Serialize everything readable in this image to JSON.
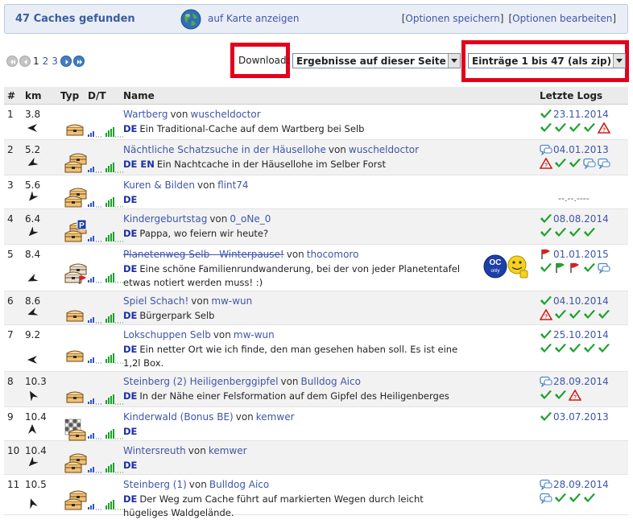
{
  "header": {
    "caches_found": "47 Caches gefunden",
    "map_link": "auf Karte anzeigen",
    "options_save": "Optionen speichern",
    "options_edit": "Optionen bearbeiten"
  },
  "pager": {
    "pages": [
      "1",
      "2",
      "3"
    ],
    "current": "1"
  },
  "download": {
    "label": "Download:",
    "results_select": "Ergebnisse auf dieser Seite",
    "entries_select": "Einträge 1 bis 47 (als zip)"
  },
  "table": {
    "headers": {
      "num": "#",
      "km": "km",
      "type": "Typ",
      "dt": "D/T",
      "name": "Name",
      "logs": "Letzte Logs"
    },
    "rows": [
      {
        "num": "1",
        "km": "3.8",
        "name": "Wartberg",
        "von": "von",
        "owner": "wuscheldoctor",
        "langs": "DE",
        "desc": "Ein Traditional-Cache auf dem Wartberg bei Selb",
        "log_date": "23.11.2014",
        "log_date_icon": "check-icon",
        "logs": [
          "check-icon",
          "check-icon",
          "check-icon",
          "check-icon",
          "dnf-icon"
        ],
        "type_icon": "traditional-cache-icon"
      },
      {
        "num": "2",
        "km": "5.2",
        "name": "Nächtliche Schatzsuche in der Häusellohe",
        "von": "von",
        "owner": "wuscheldoctor",
        "langs": "DE EN",
        "desc": "Ein Nachtcache in der Häusellohe im Selber Forst",
        "log_date": "04.01.2013",
        "log_date_icon": "note-icon",
        "logs": [
          "dnf-icon",
          "check-icon",
          "check-icon",
          "note-icon",
          "note-icon"
        ],
        "type_icon": "multi-cache-icon"
      },
      {
        "num": "3",
        "km": "5.6",
        "name": "Kuren & Bilden",
        "von": "von",
        "owner": "flint74",
        "langs": "DE",
        "desc": "",
        "log_date": "",
        "no_log": "--.--.----",
        "logs": [],
        "type_icon": "multi-cache-icon"
      },
      {
        "num": "4",
        "km": "6.4",
        "name": "Kindergeburtstag",
        "von": "von",
        "owner": "0_oNe_0",
        "langs": "DE",
        "desc": "Pappa, wo feiern wir heute?",
        "log_date": "08.08.2014",
        "log_date_icon": "check-icon",
        "logs": [
          "check-icon",
          "check-icon",
          "check-icon",
          "check-icon"
        ],
        "type_icon": "multi-cache-parking-icon"
      },
      {
        "num": "5",
        "km": "8.4",
        "name": "Planetenweg Selb - Winterpause!",
        "von": "von",
        "owner": "thocomoro",
        "langs": "DE",
        "desc": "Eine schöne Familienrundwanderung, bei der von jeder Planetentafel etwas notiert werden muss! :)",
        "log_date": "01.01.2015",
        "log_date_icon": "flag-red-icon",
        "logs": [
          "check-icon",
          "flag-green-icon",
          "flag-red-icon",
          "check-icon",
          "note-icon"
        ],
        "type_icon": "multi-cache-disabled-icon",
        "badge": "OC only",
        "archived": true
      },
      {
        "num": "6",
        "km": "8.6",
        "name": "Spiel Schach!",
        "von": "von",
        "owner": "mw-wun",
        "langs": "DE",
        "desc": "Bürgerpark Selb",
        "log_date": "04.10.2014",
        "log_date_icon": "check-icon",
        "logs": [
          "dnf-icon",
          "check-icon",
          "check-icon",
          "check-icon",
          "check-icon"
        ],
        "type_icon": "traditional-cache-icon"
      },
      {
        "num": "7",
        "km": "9.2",
        "name": "Lokschuppen Selb",
        "von": "von",
        "owner": "mw-wun",
        "langs": "DE",
        "desc": "Ein netter Ort wie ich finde, den man gesehen haben soll. Es ist eine 1,2l Box.",
        "log_date": "25.10.2014",
        "log_date_icon": "check-icon",
        "logs": [
          "check-icon",
          "check-icon",
          "check-icon",
          "check-icon",
          "check-icon"
        ],
        "type_icon": "traditional-cache-icon"
      },
      {
        "num": "8",
        "km": "10.3",
        "name": "Steinberg (2) Heiligenberggipfel",
        "von": "von",
        "owner": "Bulldog Aico",
        "langs": "DE",
        "desc": "In der Nähe einer Felsformation auf dem Gipfel des Heiligenberges",
        "log_date": "28.09.2014",
        "log_date_icon": "note-icon",
        "logs": [
          "check-icon",
          "check-icon",
          "dnf-icon"
        ],
        "type_icon": "traditional-cache-icon"
      },
      {
        "num": "9",
        "km": "10.4",
        "name": "Kinderwald (Bonus BE)",
        "von": "von",
        "owner": "kemwer",
        "langs": "DE",
        "desc": "",
        "log_date": "03.07.2013",
        "log_date_icon": "check-icon",
        "logs": [],
        "type_icon": "mystery-cache-icon"
      },
      {
        "num": "10",
        "km": "10.4",
        "name": "Wintersreuth",
        "von": "von",
        "owner": "kemwer",
        "langs": "DE",
        "desc": "",
        "log_date": "",
        "logs": [],
        "type_icon": "multi-cache-icon"
      },
      {
        "num": "11",
        "km": "10.5",
        "name": "Steinberg (1)",
        "von": "von",
        "owner": "Bulldog Aico",
        "langs": "DE",
        "desc": "Der Weg zum Cache führt auf markierten Wegen durch leicht hügeliges Waldgelände.",
        "log_date": "28.09.2014",
        "log_date_icon": "note-icon",
        "logs": [
          "note-icon",
          "check-icon",
          "check-icon",
          "check-icon"
        ],
        "type_icon": "multi-cache-icon"
      }
    ]
  }
}
